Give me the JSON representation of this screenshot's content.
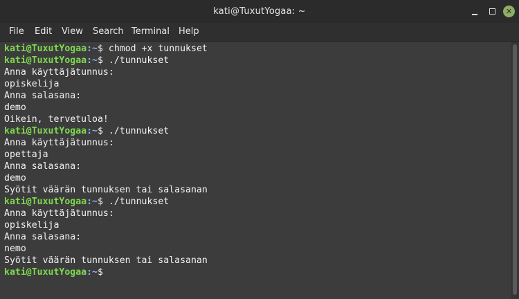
{
  "window": {
    "title": "kati@TuxutYogaa: ~"
  },
  "menu": [
    "File",
    "Edit",
    "View",
    "Search",
    "Terminal",
    "Help"
  ],
  "prompt": {
    "user": "kati@TuxutYogaa",
    "path": "~",
    "symbol": "$"
  },
  "lines": [
    {
      "type": "cmd",
      "text": "chmod +x tunnukset"
    },
    {
      "type": "cmd",
      "text": "./tunnukset"
    },
    {
      "type": "out",
      "text": "Anna käyttäjätunnus:"
    },
    {
      "type": "out",
      "text": "opiskelija"
    },
    {
      "type": "out",
      "text": "Anna salasana:"
    },
    {
      "type": "out",
      "text": "demo"
    },
    {
      "type": "out",
      "text": "Oikein, tervetuloa!"
    },
    {
      "type": "cmd",
      "text": "./tunnukset"
    },
    {
      "type": "out",
      "text": "Anna käyttäjätunnus:"
    },
    {
      "type": "out",
      "text": "opettaja"
    },
    {
      "type": "out",
      "text": "Anna salasana:"
    },
    {
      "type": "out",
      "text": "demo"
    },
    {
      "type": "out",
      "text": "Syötit väärän tunnuksen tai salasanan"
    },
    {
      "type": "cmd",
      "text": "./tunnukset"
    },
    {
      "type": "out",
      "text": "Anna käyttäjätunnus:"
    },
    {
      "type": "out",
      "text": "opiskelija"
    },
    {
      "type": "out",
      "text": "Anna salasana:"
    },
    {
      "type": "out",
      "text": "nemo"
    },
    {
      "type": "out",
      "text": "Syötit väärän tunnuksen tai salasanan"
    },
    {
      "type": "cmd",
      "text": ""
    }
  ],
  "colors": {
    "prompt_user": "#7fd94f",
    "prompt_path": "#8ab4f8",
    "terminal_bg": "#3c3c3c",
    "text": "#f2f2f2"
  },
  "icons": {
    "minimize": "minimize-icon",
    "maximize": "maximize-icon",
    "close": "close-icon"
  }
}
